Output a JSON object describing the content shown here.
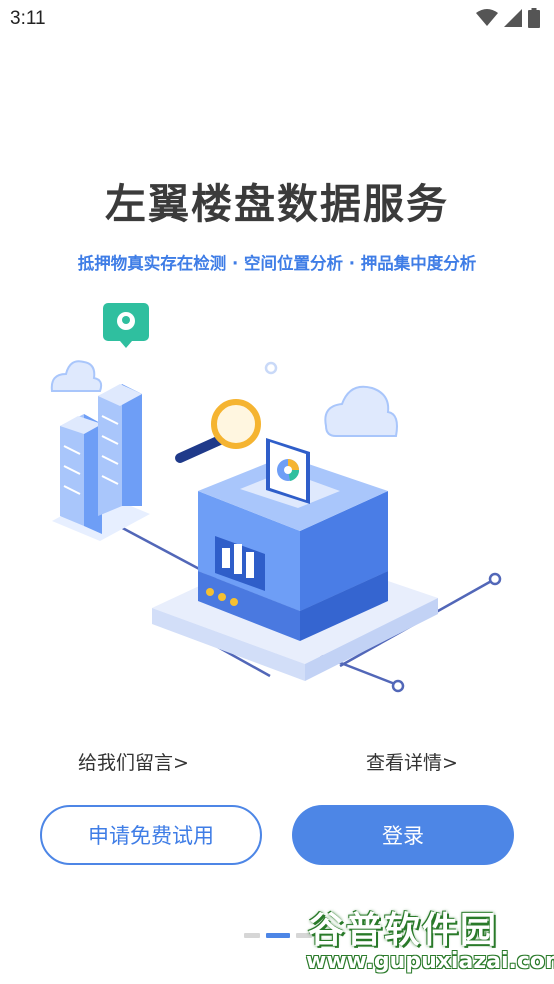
{
  "status_bar": {
    "time": "3:11",
    "icons": [
      "wifi-icon",
      "signal-icon",
      "battery-icon"
    ]
  },
  "main": {
    "title": "左翼楼盘数据服务",
    "subtitle": "抵押物真实存在检测 · 空间位置分析 · 押品集中度分析"
  },
  "links": {
    "message": "给我们留言>",
    "details": "查看详情>"
  },
  "buttons": {
    "trial": "申请免费试用",
    "login": "登录"
  },
  "pager": {
    "count": 3,
    "active_index": 1
  },
  "watermark": {
    "title": "谷普软件园",
    "url": "www.gupuxiazai.com"
  },
  "colors": {
    "accent": "#4d86e6",
    "title_text": "#3b3b3b",
    "illustration_light": "#a9c6fb",
    "illustration_mid": "#6e9ef6",
    "pin": "#2fbf9f",
    "magnifier": "#f5b431"
  }
}
